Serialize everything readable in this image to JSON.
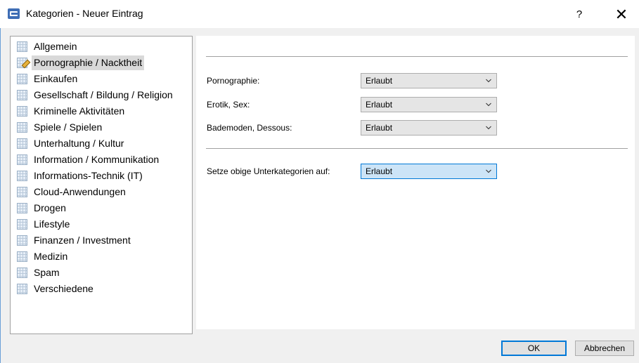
{
  "window": {
    "title": "Kategorien - Neuer Eintrag",
    "help_glyph": "?",
    "close_glyph": "✕"
  },
  "categories": [
    {
      "label": "Allgemein",
      "icon": "grid-icon"
    },
    {
      "label": "Pornographie / Nacktheit",
      "icon": "grid-edit-icon",
      "selected": true
    },
    {
      "label": "Einkaufen",
      "icon": "grid-icon"
    },
    {
      "label": "Gesellschaft / Bildung / Religion",
      "icon": "grid-icon"
    },
    {
      "label": "Kriminelle Aktivitäten",
      "icon": "grid-icon"
    },
    {
      "label": "Spiele / Spielen",
      "icon": "grid-icon"
    },
    {
      "label": "Unterhaltung / Kultur",
      "icon": "grid-icon"
    },
    {
      "label": "Information / Kommunikation",
      "icon": "grid-icon"
    },
    {
      "label": "Informations-Technik (IT)",
      "icon": "grid-icon"
    },
    {
      "label": "Cloud-Anwendungen",
      "icon": "grid-icon"
    },
    {
      "label": "Drogen",
      "icon": "grid-icon"
    },
    {
      "label": "Lifestyle",
      "icon": "grid-icon"
    },
    {
      "label": "Finanzen / Investment",
      "icon": "grid-icon"
    },
    {
      "label": "Medizin",
      "icon": "grid-icon"
    },
    {
      "label": "Spam",
      "icon": "grid-icon"
    },
    {
      "label": "Verschiedene",
      "icon": "grid-icon"
    }
  ],
  "subcategories": [
    {
      "label": "Pornographie:",
      "value": "Erlaubt"
    },
    {
      "label": "Erotik, Sex:",
      "value": "Erlaubt"
    },
    {
      "label": "Bademoden, Dessous:",
      "value": "Erlaubt"
    }
  ],
  "set_all": {
    "label": "Setze obige Unterkategorien auf:",
    "value": "Erlaubt"
  },
  "buttons": {
    "ok": "OK",
    "cancel": "Abbrechen"
  },
  "colors": {
    "accent": "#0078d7",
    "focus_fill": "#cce4f7",
    "selection": "#d9d9d9"
  }
}
